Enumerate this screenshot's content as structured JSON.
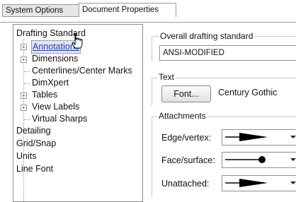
{
  "tabs": [
    {
      "label": "System Options"
    },
    {
      "label": "Document Properties"
    }
  ],
  "tree": {
    "items": [
      {
        "label": "Drafting Standard"
      },
      {
        "label": "Annotations"
      },
      {
        "label": "Dimensions"
      },
      {
        "label": "Centerlines/Center Marks"
      },
      {
        "label": "DimXpert"
      },
      {
        "label": "Tables"
      },
      {
        "label": "View Labels"
      },
      {
        "label": "Virtual Sharps"
      },
      {
        "label": "Detailing"
      },
      {
        "label": "Grid/Snap"
      },
      {
        "label": "Units"
      },
      {
        "label": "Line Font"
      }
    ]
  },
  "drafting": {
    "group_title": "Overall drafting standard",
    "value": "ANSI-MODIFIED"
  },
  "text_group": {
    "title": "Text",
    "font_button": "Font...",
    "font_name": "Century Gothic"
  },
  "attachments": {
    "title": "Attachments",
    "rows": [
      {
        "label": "Edge/vertex:",
        "symbol": "filled-arrow-icon"
      },
      {
        "label": "Face/surface:",
        "symbol": "filled-dot-icon"
      },
      {
        "label": "Unattached:",
        "symbol": "filled-arrow-icon"
      }
    ]
  }
}
